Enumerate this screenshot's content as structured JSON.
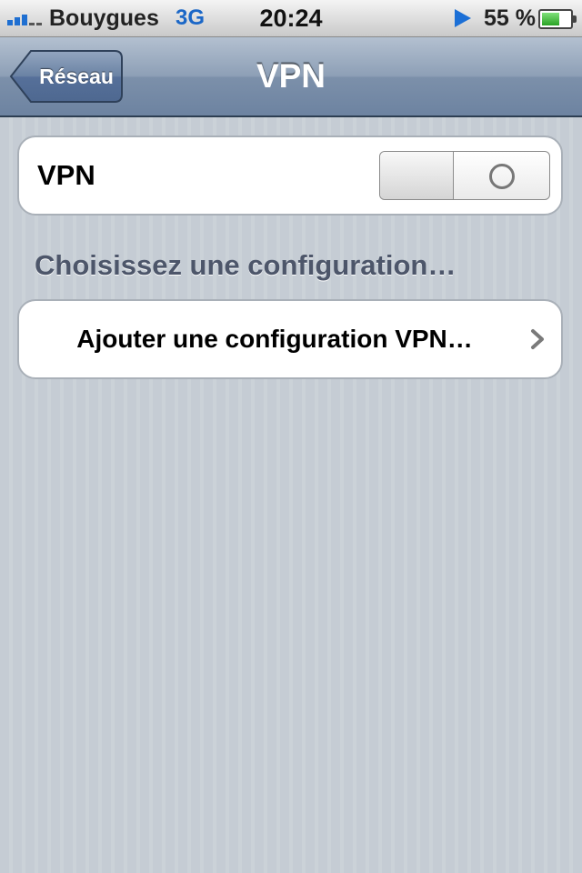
{
  "status_bar": {
    "carrier": "Bouygues",
    "network": "3G",
    "time": "20:24",
    "battery": "55 %",
    "signal_icon": "signal-bars-icon",
    "location_icon": "play-arrow-icon",
    "battery_icon": "battery-icon"
  },
  "nav": {
    "back_label": "Réseau",
    "title": "VPN"
  },
  "vpn_row": {
    "label": "VPN",
    "toggle_on": false
  },
  "section": {
    "header": "Choisissez une configuration…"
  },
  "config_row": {
    "label": "Ajouter une configuration VPN…",
    "icon": "chevron-right-icon"
  },
  "colors": {
    "background": "#c5ccd4",
    "nav_bar": "#7c90aa",
    "section_text": "#4d566a",
    "network_text": "#1b67c7",
    "location_arrow": "#1b6fd6",
    "battery_fill": "#2aa325"
  }
}
